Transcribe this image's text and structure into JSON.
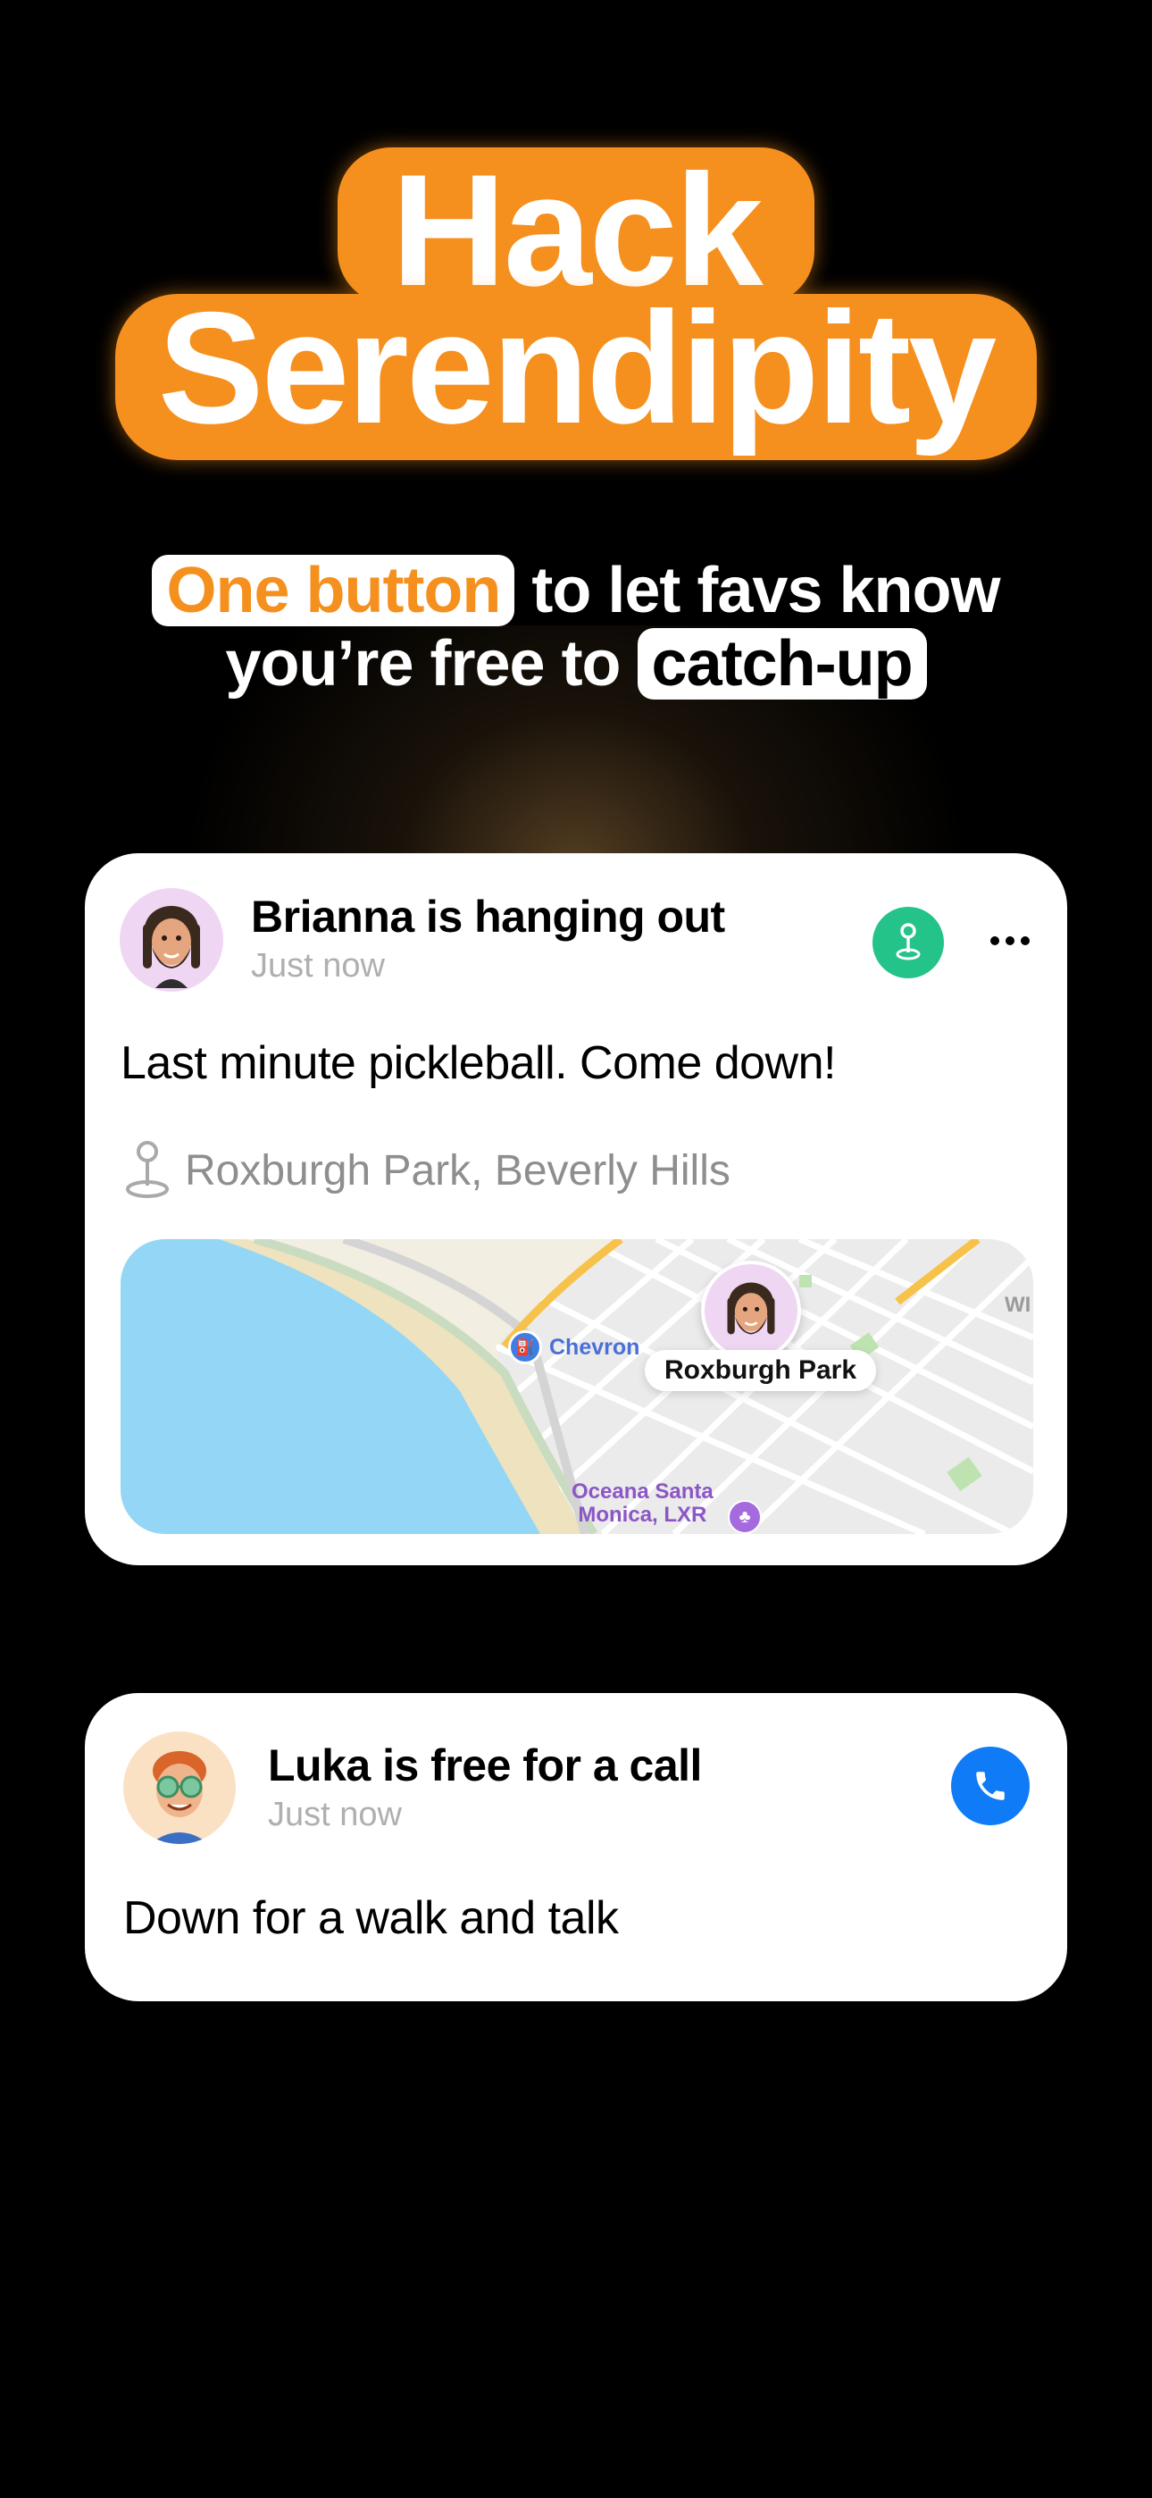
{
  "hero": {
    "line1": "Hack",
    "line2": "Serendipity",
    "accent_color": "#F5901E"
  },
  "subtitle": {
    "highlight1": "One button",
    "text1": " to let favs know",
    "text2": "you’re free to ",
    "highlight2": "catch-up"
  },
  "cards": [
    {
      "title": "Brianna is hanging out",
      "time": "Just now",
      "message": "Last minute pickleball. Come down!",
      "location": "Roxburgh Park, Beverly Hills",
      "action_icon": "location-pin-icon",
      "action_color": "#23C38A",
      "map": {
        "place_label": "Roxburgh Park",
        "poi_chevron": "Chevron",
        "poi_line1": "Oceana Santa",
        "poi_line2": "Monica, LXR",
        "edge_text": "WI"
      }
    },
    {
      "title": "Luka is free for a call",
      "time": "Just now",
      "message": "Down for a walk and talk",
      "action_icon": "phone-icon",
      "action_color": "#0F7BF6"
    }
  ]
}
